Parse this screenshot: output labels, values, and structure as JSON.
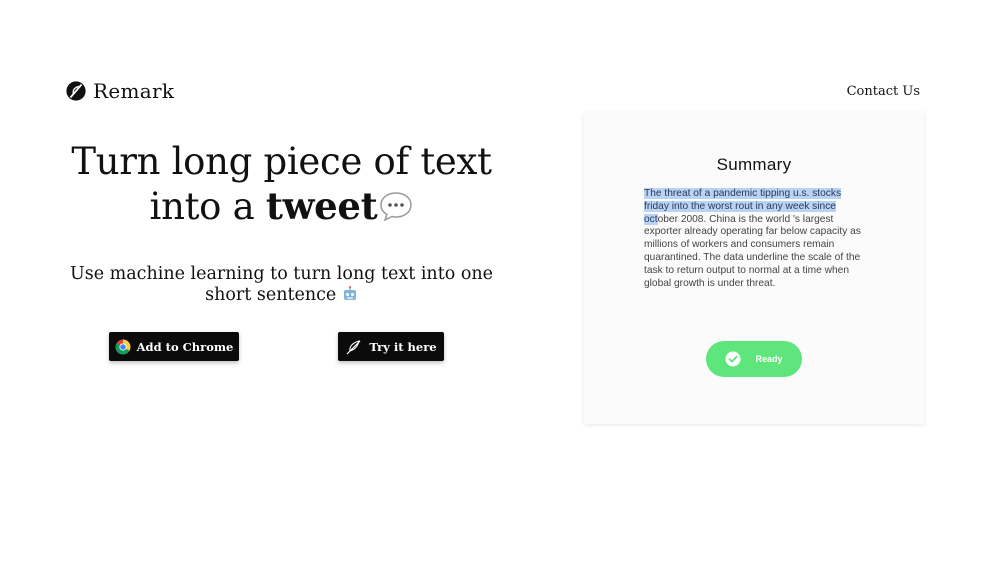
{
  "brand": {
    "name": "Remark",
    "icon": "leaf-logo-icon"
  },
  "nav": {
    "contact": "Contact Us"
  },
  "hero": {
    "title_part1": "Turn long piece of text into a",
    "title_bold": "tweet",
    "title_icon": "speech-bubble-icon",
    "subtitle": "Use machine learning to turn long text into one short sentence",
    "subtitle_icon": "robot-icon"
  },
  "buttons": {
    "chrome_label": "Add to Chrome",
    "chrome_icon": "chrome-icon",
    "try_label": "Try it here",
    "try_icon": "feather-icon"
  },
  "summary_card": {
    "title": "Summary",
    "text_highlighted": "The threat of a pandemic tipping u.s. stocks friday into the worst rout in any week since oct",
    "text_rest": "ober 2008. China is the world 's largest exporter already operating far below capacity as millions of workers and consumers remain quarantined. The data underline the scale of the task to return output to normal at a time when global growth is under threat.",
    "status_label": "Ready",
    "status_icon": "check-circle-icon"
  },
  "colors": {
    "button_bg": "#0b0b0b",
    "highlight": "#b9d3f5",
    "ready_green": "#5ee67c",
    "card_bg": "#fbfbfb"
  }
}
